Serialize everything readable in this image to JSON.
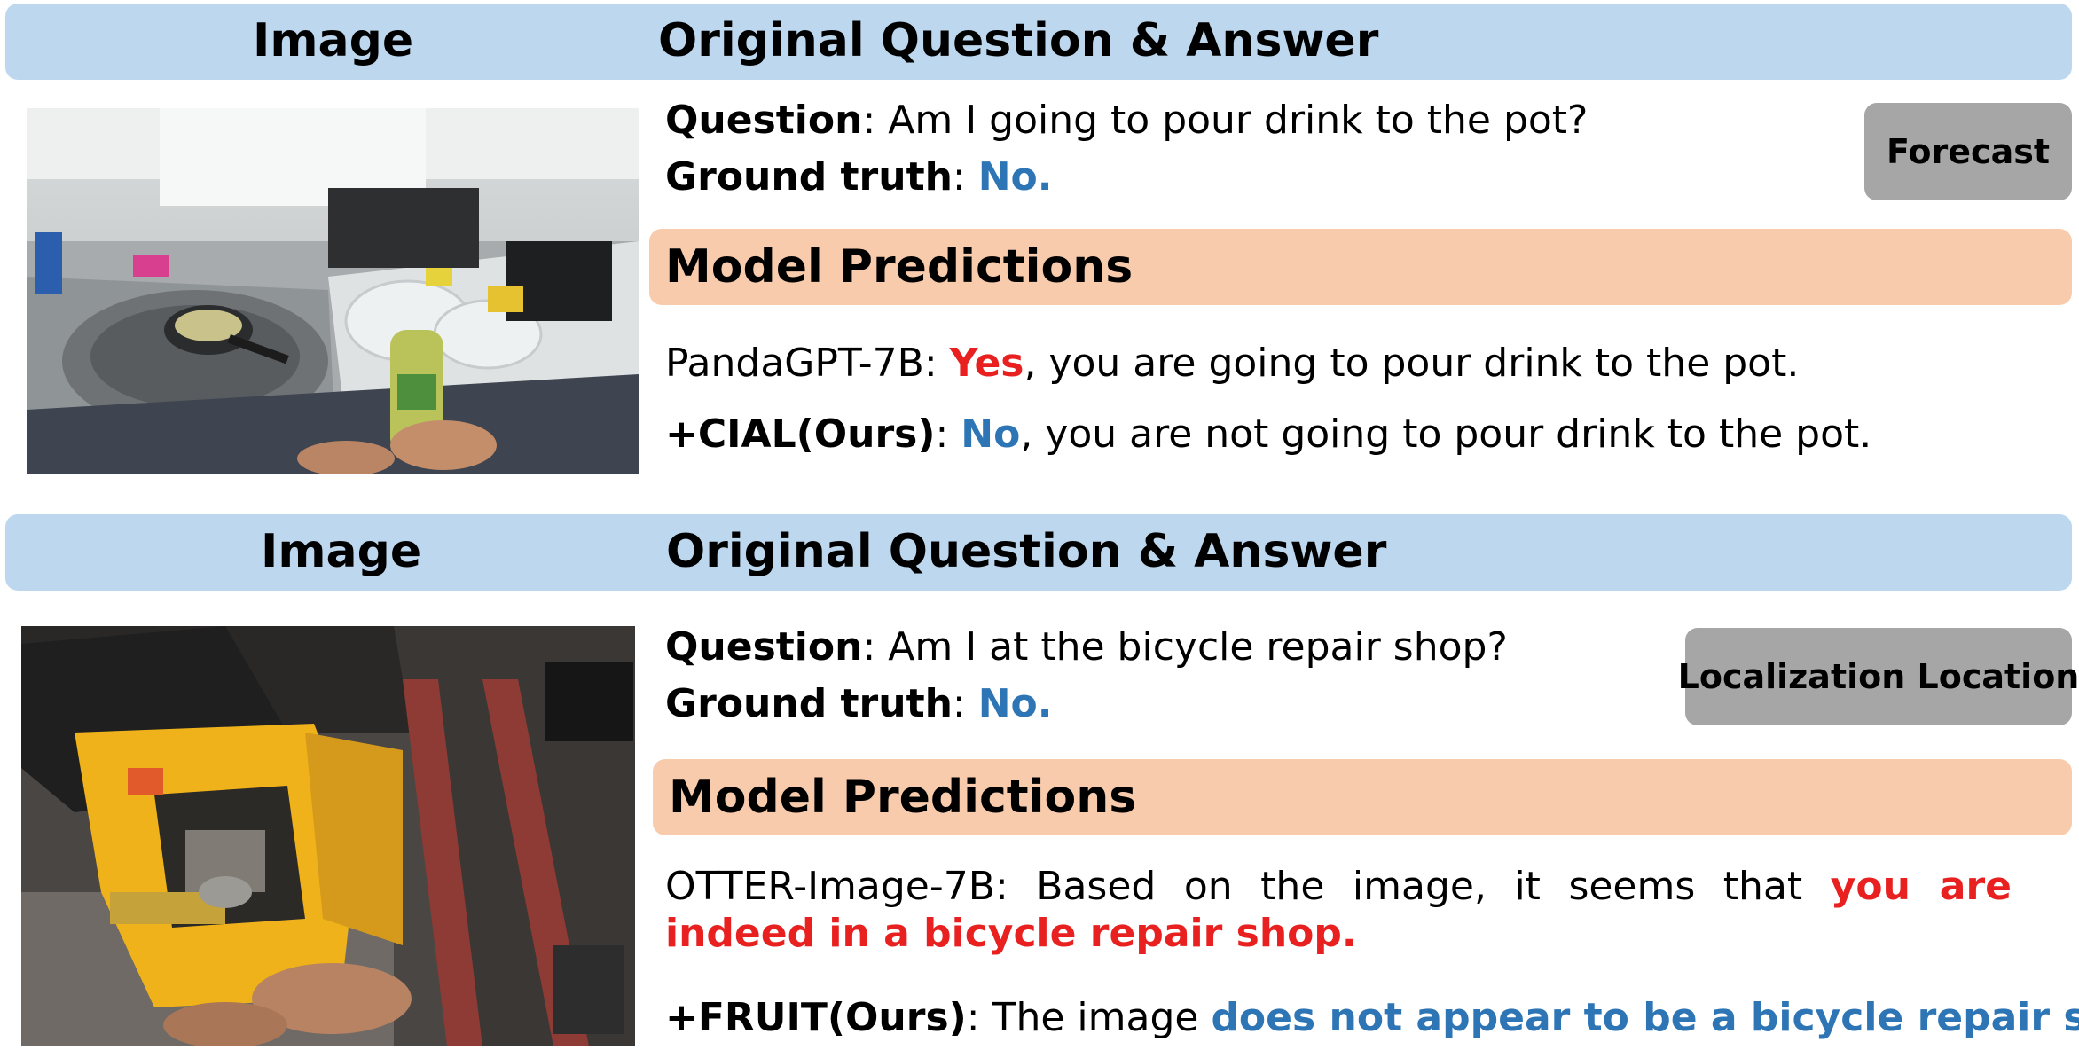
{
  "panels": [
    {
      "header": {
        "image_label": "Image",
        "qa_label": "Original Question & Answer"
      },
      "question_label": "Question",
      "question": "Am I going to pour drink to the pot?",
      "gt_label": "Ground truth",
      "gt_value": "No.",
      "tag": "Forecast",
      "predictions_title": "Model Predictions",
      "baseline": {
        "model": "PandaGPT-7B",
        "highlight": "Yes",
        "rest": ", you are going to pour drink to the pot."
      },
      "ours": {
        "model": "+CIAL(Ours)",
        "highlight": "No",
        "rest": ", you are not going to pour drink to the pot."
      }
    },
    {
      "header": {
        "image_label": "Image",
        "qa_label": "Original Question & Answer"
      },
      "question_label": "Question",
      "question": "Am I at the bicycle repair shop?",
      "gt_label": "Ground truth",
      "gt_value": "No.",
      "tag": "Localization Location",
      "predictions_title": "Model Predictions",
      "baseline": {
        "model": "OTTER-Image-7B",
        "pre": "Based on the image, it seems that ",
        "highlight": "you are indeed in a bicycle repair shop."
      },
      "ours": {
        "model": "+FRUIT(Ours)",
        "pre": "The image ",
        "highlight": "does not appear to be a bicycle repair shop",
        "post": "."
      }
    }
  ],
  "colors": {
    "header_bg": "#bdd7ee",
    "predictions_bg": "#f8cbad",
    "tag_bg": "#a6a6a6",
    "correct": "#2e75b6",
    "wrong": "#e82020"
  }
}
